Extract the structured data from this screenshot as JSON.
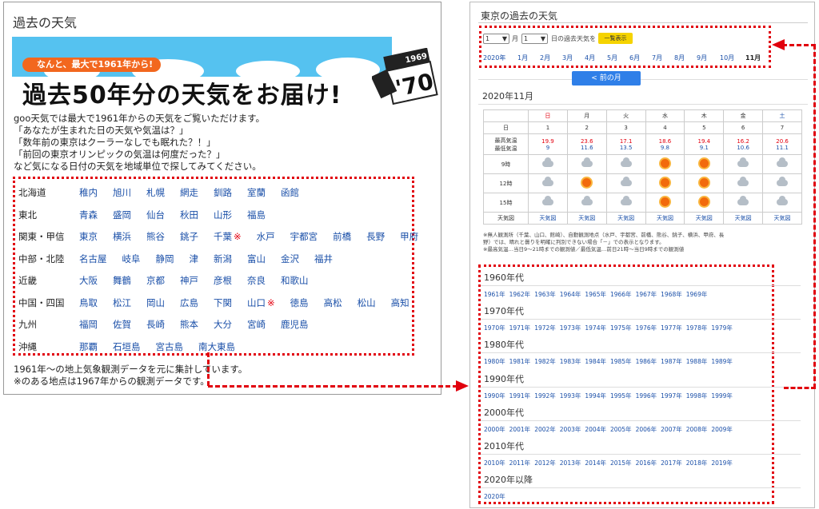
{
  "left": {
    "title": "過去の天気",
    "banner": {
      "tagline": "なんと、最大で1961年から!",
      "headline": "過去50年分の天気をお届け!",
      "calendar_year": "1969",
      "calendar_digits": "'70"
    },
    "intro": [
      "goo天気では最大で1961年からの天気をご覧いただけます。",
      "「あなたが生まれた日の天気や気温は？」",
      "「数年前の東京はクーラーなしでも眠れた？！」",
      "「前回の東京オリンピックの気温は何度だった？」",
      "など気になる日付の天気を地域単位で探してみてください。"
    ],
    "regions": [
      {
        "name": "北海道",
        "cities": [
          {
            "n": "稚内"
          },
          {
            "n": "旭川"
          },
          {
            "n": "札幌"
          },
          {
            "n": "網走"
          },
          {
            "n": "釧路"
          },
          {
            "n": "室蘭"
          },
          {
            "n": "函館"
          }
        ]
      },
      {
        "name": "東北",
        "cities": [
          {
            "n": "青森"
          },
          {
            "n": "盛岡"
          },
          {
            "n": "仙台"
          },
          {
            "n": "秋田"
          },
          {
            "n": "山形"
          },
          {
            "n": "福島"
          }
        ]
      },
      {
        "name": "関東・甲信",
        "cities": [
          {
            "n": "東京"
          },
          {
            "n": "横浜"
          },
          {
            "n": "熊谷"
          },
          {
            "n": "銚子"
          },
          {
            "n": "千葉",
            "m": "※"
          },
          {
            "n": "水戸"
          },
          {
            "n": "宇都宮"
          },
          {
            "n": "前橋"
          },
          {
            "n": "長野"
          },
          {
            "n": "甲府"
          }
        ]
      },
      {
        "name": "中部・北陸",
        "cities": [
          {
            "n": "名古屋"
          },
          {
            "n": "岐阜"
          },
          {
            "n": "静岡"
          },
          {
            "n": "津"
          },
          {
            "n": "新潟"
          },
          {
            "n": "富山"
          },
          {
            "n": "金沢"
          },
          {
            "n": "福井"
          }
        ]
      },
      {
        "name": "近畿",
        "cities": [
          {
            "n": "大阪"
          },
          {
            "n": "舞鶴"
          },
          {
            "n": "京都"
          },
          {
            "n": "神戸"
          },
          {
            "n": "彦根"
          },
          {
            "n": "奈良"
          },
          {
            "n": "和歌山"
          }
        ]
      },
      {
        "name": "中国・四国",
        "cities": [
          {
            "n": "鳥取"
          },
          {
            "n": "松江"
          },
          {
            "n": "岡山"
          },
          {
            "n": "広島"
          },
          {
            "n": "下関"
          },
          {
            "n": "山口",
            "m": "※"
          },
          {
            "n": "徳島"
          },
          {
            "n": "高松"
          },
          {
            "n": "松山"
          },
          {
            "n": "高知"
          }
        ]
      },
      {
        "name": "九州",
        "cities": [
          {
            "n": "福岡"
          },
          {
            "n": "佐賀"
          },
          {
            "n": "長崎"
          },
          {
            "n": "熊本"
          },
          {
            "n": "大分"
          },
          {
            "n": "宮崎"
          },
          {
            "n": "鹿児島"
          }
        ]
      },
      {
        "name": "沖縄",
        "cities": [
          {
            "n": "那覇"
          },
          {
            "n": "石垣島"
          },
          {
            "n": "宮古島"
          },
          {
            "n": "南大東島"
          }
        ]
      }
    ],
    "footnote": [
      "1961年～の地上気象観測データを元に集計しています。",
      "※のある地点は1967年からの観測データです。"
    ]
  },
  "right": {
    "title": "東京の過去の天気",
    "month_select": "1",
    "month_suffix": "月",
    "day_select": "1",
    "day_suffix": "日の過去天気を",
    "show_button": "一覧表示",
    "months": [
      "2020年",
      "1月",
      "2月",
      "3月",
      "4月",
      "5月",
      "6月",
      "7月",
      "8月",
      "9月",
      "10月",
      "11月"
    ],
    "current_month": "11月",
    "prev_button": "< 前の月",
    "month_heading": "2020年11月",
    "table": {
      "weekdays": [
        "日",
        "月",
        "火",
        "水",
        "木",
        "金",
        "土"
      ],
      "day_label": "日",
      "days": [
        "1",
        "2",
        "3",
        "4",
        "5",
        "6",
        "7"
      ],
      "hi_label": "最高気温",
      "lo_label": "最低気温",
      "highs": [
        "19.9",
        "23.6",
        "17.1",
        "18.6",
        "19.4",
        "16.2",
        "20.6"
      ],
      "lows": [
        "9",
        "11.6",
        "13.5",
        "9.8",
        "9.1",
        "10.6",
        "11.1"
      ],
      "times": [
        {
          "label": "9時",
          "icons": [
            "cloud",
            "cloud",
            "cloud",
            "sun",
            "sun",
            "cloud",
            "cloud"
          ]
        },
        {
          "label": "12時",
          "icons": [
            "cloud",
            "sun",
            "cloud",
            "sun",
            "sun",
            "cloud",
            "cloud"
          ]
        },
        {
          "label": "15時",
          "icons": [
            "cloud",
            "cloud",
            "cloud",
            "sun",
            "sun",
            "cloud",
            "cloud"
          ]
        }
      ],
      "map_label": "天気図",
      "map_links": [
        "天気図",
        "天気図",
        "天気図",
        "天気図",
        "天気図",
        "天気図",
        "天気図"
      ]
    },
    "notes": [
      "※無人観測所（千葉、山口、館崎）、自動観測地点（水戸、宇都宮、前橋、熊谷、銚子、横浜、甲府、長",
      "野）では、晴れと曇りを明確に判別できない場合「－」での表示となります。",
      "※最高気温…当日9～21時までの観測値／最低気温…前日21時～当日9時までの観測値"
    ],
    "decades": [
      {
        "title": "1960年代",
        "years": [
          "1961年",
          "1962年",
          "1963年",
          "1964年",
          "1965年",
          "1966年",
          "1967年",
          "1968年",
          "1969年"
        ]
      },
      {
        "title": "1970年代",
        "years": [
          "1970年",
          "1971年",
          "1972年",
          "1973年",
          "1974年",
          "1975年",
          "1976年",
          "1977年",
          "1978年",
          "1979年"
        ]
      },
      {
        "title": "1980年代",
        "years": [
          "1980年",
          "1981年",
          "1982年",
          "1983年",
          "1984年",
          "1985年",
          "1986年",
          "1987年",
          "1988年",
          "1989年"
        ]
      },
      {
        "title": "1990年代",
        "years": [
          "1990年",
          "1991年",
          "1992年",
          "1993年",
          "1994年",
          "1995年",
          "1996年",
          "1997年",
          "1998年",
          "1999年"
        ]
      },
      {
        "title": "2000年代",
        "years": [
          "2000年",
          "2001年",
          "2002年",
          "2003年",
          "2004年",
          "2005年",
          "2006年",
          "2007年",
          "2008年",
          "2009年"
        ]
      },
      {
        "title": "2010年代",
        "years": [
          "2010年",
          "2011年",
          "2012年",
          "2013年",
          "2014年",
          "2015年",
          "2016年",
          "2017年",
          "2018年",
          "2019年"
        ]
      },
      {
        "title": "2020年以降",
        "years": [
          "2020年"
        ]
      }
    ]
  },
  "colors": {
    "accent_red": "#e1000d",
    "link_blue": "#1a4fa8",
    "banner_orange": "#f2671e",
    "sky_blue": "#55c2f0",
    "button_blue": "#2f7fe8",
    "button_yellow": "#f5d300"
  }
}
